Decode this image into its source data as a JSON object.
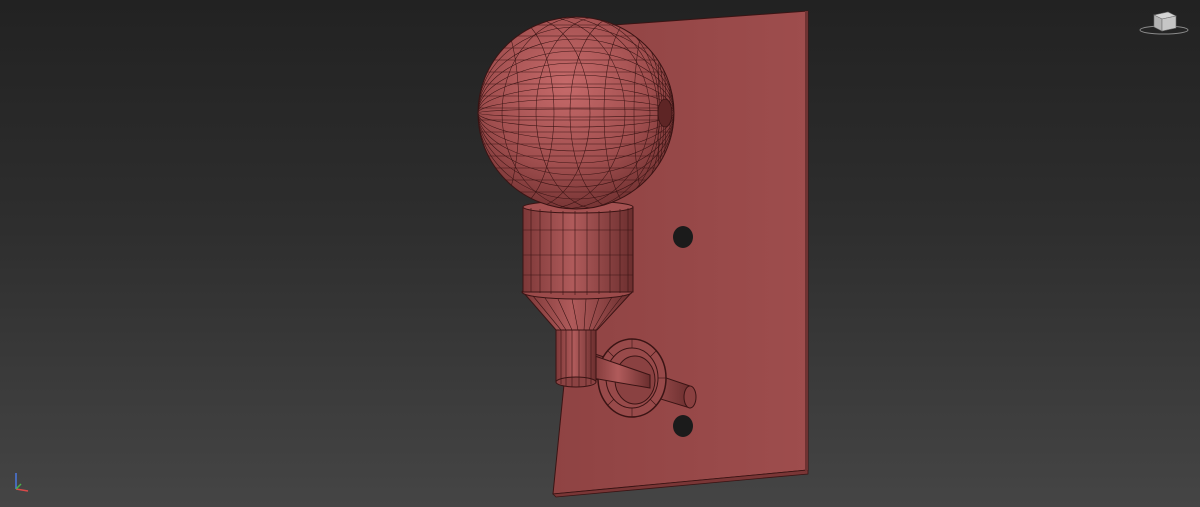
{
  "viewport": {
    "background_top": "#222222",
    "background_bottom": "#454545",
    "model_color": "#a14f4f",
    "wire_color": "#3a1414"
  },
  "navigation": {
    "viewcube_icon": "viewcube-icon",
    "axis_icon": "axis-tripod-icon"
  }
}
